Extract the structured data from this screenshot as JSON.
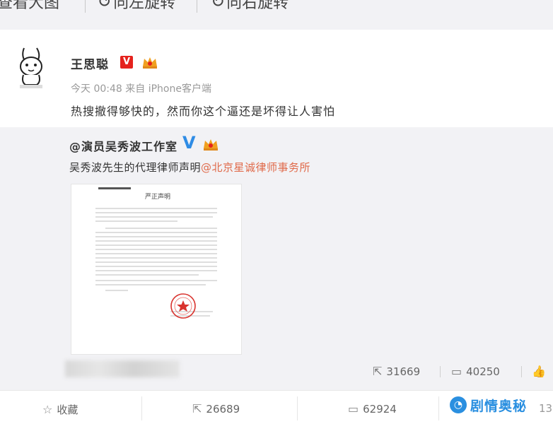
{
  "toolbar": {
    "view_large": "查看大图",
    "rotate_left": "向左旋转",
    "rotate_right": "向右旋转"
  },
  "post": {
    "username": "王思聪",
    "verified_badge": "V",
    "meta": "今天 00:48 来自 iPhone客户端",
    "text": "热搜撤得够快的，然而你这个逼还是坏得让人害怕",
    "avatar_icon": "cartoon-rabbit-avatar"
  },
  "repost": {
    "author": "@演员吴秀波工作室",
    "verified_badge": "V",
    "text": "吴秀波先生的代理律师声明",
    "mention": "@北京星诚律师事务所",
    "document": {
      "title": "严正声明",
      "stamp_icon": "red-seal-stamp"
    },
    "stats": {
      "reposts": "31669",
      "comments": "40250"
    }
  },
  "actions": {
    "favorite": "收藏",
    "reposts": "26689",
    "comments": "62924",
    "likes_partial": "13"
  },
  "watermark": {
    "text": "剧情奥秘"
  },
  "colors": {
    "background": "#f2f2f5",
    "card": "#ffffff",
    "verified_red": "#e5221d",
    "verified_blue": "#2f8ce5",
    "mention": "#e06a4a",
    "watermark": "#2a8fe0"
  }
}
